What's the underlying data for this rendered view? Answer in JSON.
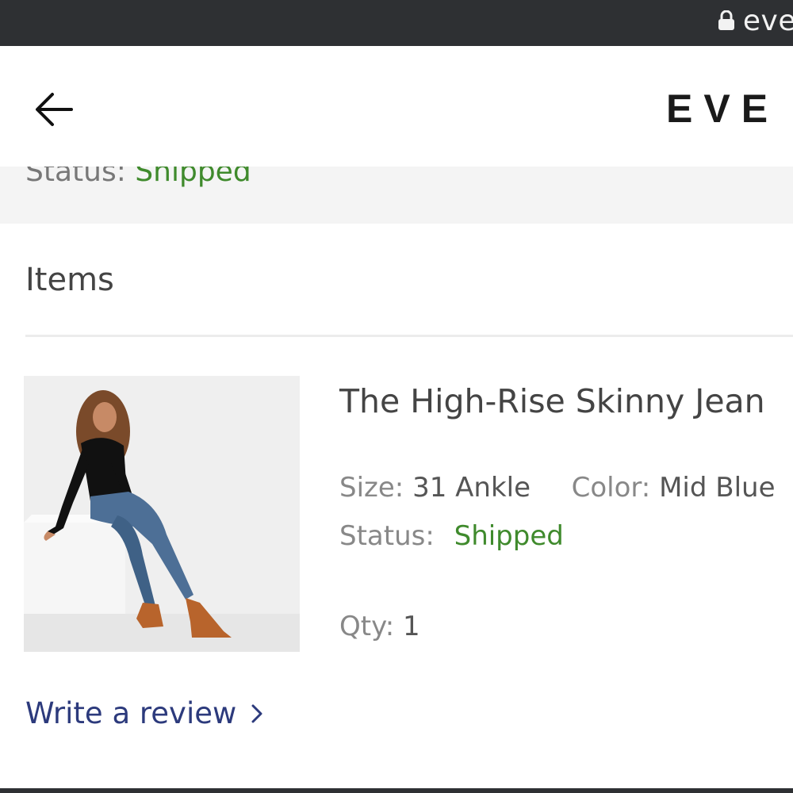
{
  "browser": {
    "url": "eve",
    "icon": "lock-icon"
  },
  "header": {
    "back_icon": "arrow-left-icon",
    "brand": "EVE"
  },
  "summary": {
    "status_label": "Status:",
    "status_value": "Shipped"
  },
  "items": {
    "title": "Items",
    "list": [
      {
        "name": "The High-Rise Skinny Jean",
        "size_label": "Size:",
        "size_value": "31 Ankle",
        "color_label": "Color:",
        "color_value": "Mid Blue",
        "status_label": "Status:",
        "status_value": "Shipped",
        "qty_label": "Qty:",
        "qty_value": "1",
        "review_label": "Write a review",
        "review_icon": "chevron-right-icon"
      }
    ]
  },
  "colors": {
    "shipped": "#3f8a2c",
    "link": "#2c3a7c",
    "browser_bar": "#2e3033"
  }
}
